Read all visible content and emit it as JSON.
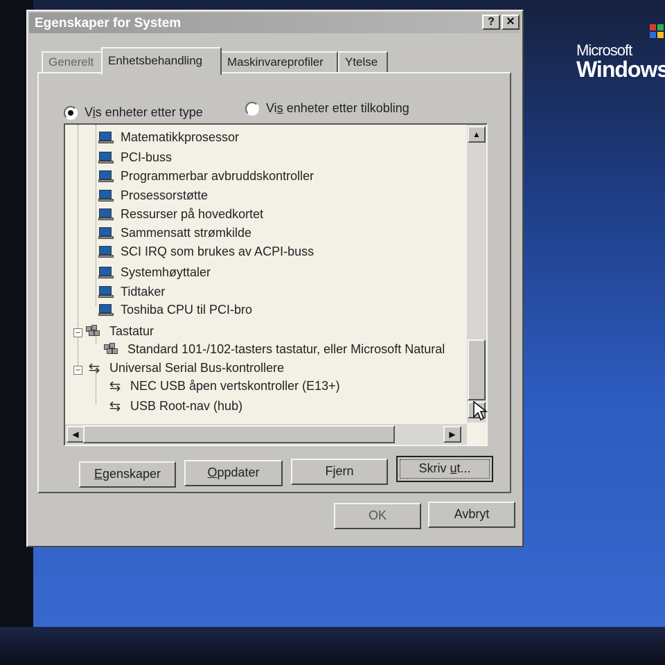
{
  "dialog": {
    "title": "Egenskaper for System",
    "help_label": "?",
    "close_label": "✕"
  },
  "tabs": [
    {
      "label": "Generelt"
    },
    {
      "label": "Enhetsbehandling"
    },
    {
      "label": "Maskinvareprofiler"
    },
    {
      "label": "Ytelse"
    }
  ],
  "view": {
    "by_type_prefix": "V",
    "by_type_hot": "i",
    "by_type_rest": "s enheter etter type",
    "by_connection_prefix": "Vi",
    "by_connection_hot": "s",
    "by_connection_rest": " enheter etter tilkobling"
  },
  "tree": {
    "system_devices": [
      "Matematikkprosessor",
      "PCI-buss",
      "Programmerbar avbruddskontroller",
      "Prosessorstøtte",
      "Ressurser på hovedkortet",
      "Sammensatt strømkilde",
      "SCI IRQ som brukes av ACPI-buss",
      "Systemhøyttaler",
      "Tidtaker",
      "Toshiba CPU til PCI-bro"
    ],
    "keyboard_group": "Tastatur",
    "keyboard_child": "Standard 101-/102-tasters tastatur, eller Microsoft Natural",
    "usb_group": "Universal Serial Bus-kontrollere",
    "usb_children": [
      "NEC USB åpen vertskontroller (E13+)",
      "USB Root-nav (hub)"
    ],
    "expander_symbol": "−"
  },
  "buttons": {
    "properties_hot": "E",
    "properties_rest": "genskaper",
    "update_hot": "O",
    "update_rest": "ppdater",
    "remove_pre": "F",
    "remove_hot": "j",
    "remove_rest": "ern",
    "print_pre": "Skriv ",
    "print_hot": "u",
    "print_rest": "t...",
    "ok": "OK",
    "cancel": "Avbryt"
  },
  "desktop": {
    "logo_line1": "Microsoft",
    "logo_line2": "Windows"
  },
  "colors": {
    "dialog_face": "#c6c4c0",
    "tree_bg": "#f3f0e6",
    "desktop_blue": "#2d5cc0",
    "device_icon_blue": "#1d5fa8"
  }
}
